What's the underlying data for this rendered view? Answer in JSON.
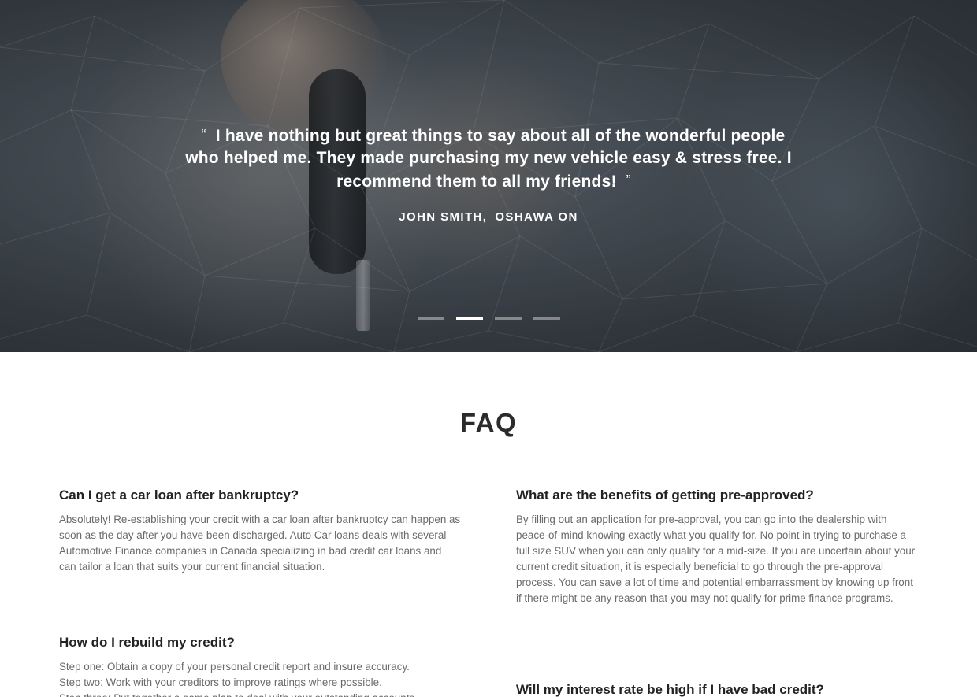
{
  "testimonial": {
    "open_quote": "“",
    "quote": "I have nothing but great things to say about all of the wonderful people who helped me. They made purchasing my new vehicle easy & stress free. I recommend them to all my friends!",
    "close_quote": "”",
    "author_name": "JOHN SMITH,",
    "author_location": "OSHAWA ON",
    "slides_count": 4,
    "active_slide": 2
  },
  "faq": {
    "title": "FAQ",
    "items": [
      {
        "question": "Can I get a car loan after bankruptcy?",
        "answer": "Absolutely! Re-establishing your credit with a car loan after bankruptcy can happen as soon as the day after you have been discharged. Auto Car loans deals with several Automotive Finance companies in Canada specializing in bad credit car loans and can tailor a loan that suits your current financial situation."
      },
      {
        "question": "What are the benefits of getting pre-approved?",
        "answer": "By filling out an application for pre-approval, you can go into the dealership with peace-of-mind knowing exactly what you qualify for. No point in trying to purchase a full size SUV when you can only qualify for a mid-size. If you are uncertain about your current credit situation, it is especially beneficial to go through the pre-approval process. You can save a lot of time and potential embarrassment by knowing up front if there might be any reason that you may not qualify for prime finance programs."
      },
      {
        "question": "How do I rebuild my credit?",
        "answer_lines": [
          "Step one: Obtain a copy of your personal credit report and insure accuracy.",
          "Step two: Work with your creditors to improve ratings where possible.",
          "Step three: Put together a game plan to deal with your outstanding accounts."
        ]
      },
      {
        "question": "Will my interest rate be high if I have bad credit?"
      }
    ]
  }
}
